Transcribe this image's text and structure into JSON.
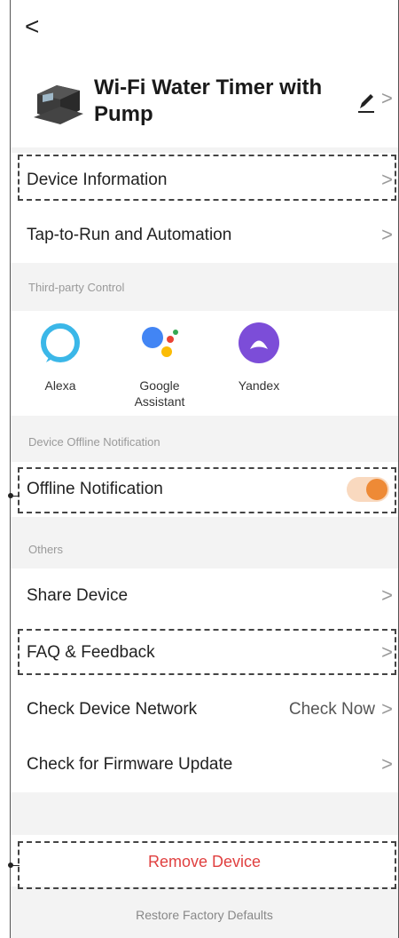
{
  "header": {
    "back_icon": "chevron-left-icon",
    "back_glyph": "<"
  },
  "device": {
    "title": "Wi-Fi Water Timer with Pump",
    "edit_icon": "pencil-icon",
    "chevron": ">"
  },
  "rows": {
    "device_information": "Device Information",
    "tap_to_run": "Tap-to-Run and Automation",
    "share_device": "Share Device",
    "faq_feedback": "FAQ & Feedback",
    "check_network": "Check Device Network",
    "check_network_value": "Check Now",
    "firmware_update": "Check for Firmware Update",
    "chevron": ">"
  },
  "sections": {
    "third_party": "Third-party Control",
    "offline": "Device Offline Notification",
    "others": "Others"
  },
  "assistants": [
    {
      "label": "Alexa",
      "icon": "alexa-icon",
      "color": "#3bb7e8"
    },
    {
      "label": "Google Assistant",
      "icon": "google-assistant-icon"
    },
    {
      "label": "Yandex",
      "icon": "yandex-alice-icon",
      "color": "#7c4dd8"
    }
  ],
  "offline_notification": {
    "label": "Offline Notification",
    "enabled": true,
    "toggle_color": "#ee8a36"
  },
  "actions": {
    "remove_device": "Remove Device",
    "restore_defaults": "Restore Factory Defaults",
    "remove_color": "#e04040"
  }
}
